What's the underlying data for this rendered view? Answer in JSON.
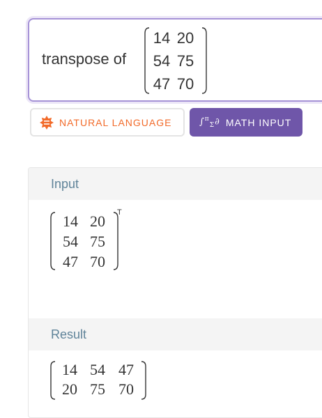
{
  "query": {
    "text": "transpose of",
    "matrix": [
      [
        "14",
        "20"
      ],
      [
        "54",
        "75"
      ],
      [
        "47",
        "70"
      ]
    ]
  },
  "modes": {
    "natural_language_label": "NATURAL LANGUAGE",
    "math_input_label": "MATH INPUT",
    "active": "math_input",
    "natural_color": "#f26a29",
    "math_bg": "#6f56a9"
  },
  "pods": {
    "input": {
      "title": "Input",
      "matrix": [
        [
          "14",
          "20"
        ],
        [
          "54",
          "75"
        ],
        [
          "47",
          "70"
        ]
      ],
      "superscript": "T"
    },
    "result": {
      "title": "Result",
      "matrix": [
        [
          "14",
          "54",
          "47"
        ],
        [
          "20",
          "75",
          "70"
        ]
      ]
    }
  }
}
